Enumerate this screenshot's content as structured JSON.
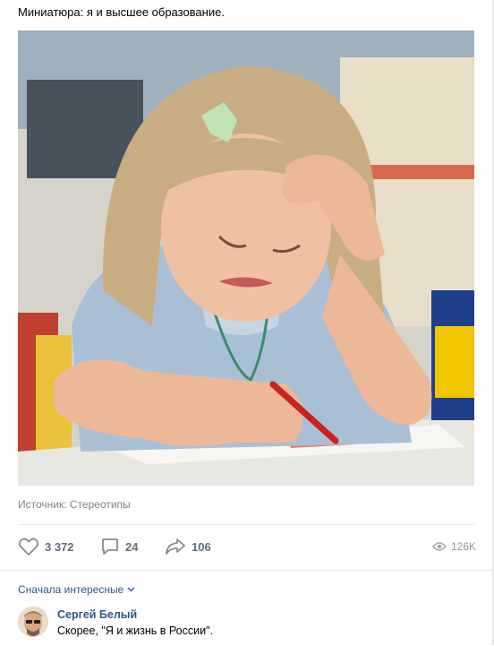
{
  "post": {
    "text": "Миниатюра: я и высшее образование.",
    "source_label": "Источник: Стереотипы"
  },
  "actions": {
    "likes": "3 372",
    "comments": "24",
    "shares": "106",
    "views": "126K"
  },
  "comments_section": {
    "sort_label": "Сначала интересные",
    "items": [
      {
        "author": "Сергей Белый",
        "text": "Скорее, \"Я и жизнь в России\"."
      }
    ]
  },
  "colors": {
    "link": "#2a5885",
    "action_gray": "#626d7a",
    "divider": "#e7e8ec"
  },
  "icons": [
    "heart-icon",
    "comment-icon",
    "share-icon",
    "eye-icon",
    "chevron-down-icon"
  ]
}
